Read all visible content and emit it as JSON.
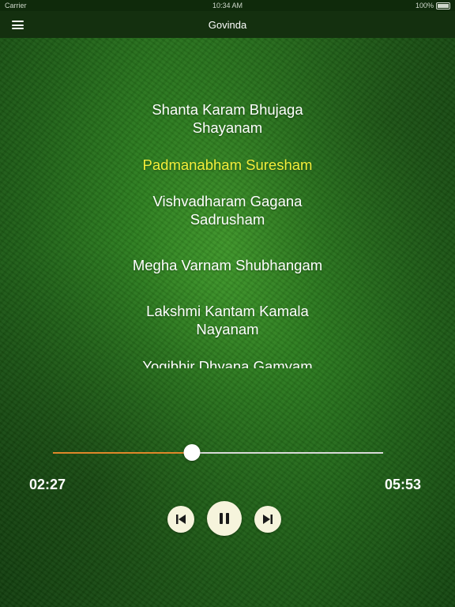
{
  "status": {
    "carrier": "Carrier",
    "time": "10:34 AM",
    "battery": "100%"
  },
  "nav": {
    "title": "Govinda",
    "menu_icon": "hamburger-menu-icon"
  },
  "lyrics": {
    "lines": [
      "Shanta Karam Bhujaga Shayanam",
      "Padmanabham Suresham",
      "Vishvadharam Gagana Sadrusham",
      "Megha Varnam Shubhangam",
      "Lakshmi Kantam Kamala Nayanam",
      "Yogibhir Dhyana Gamyam"
    ],
    "active_index": 1,
    "active_color": "#f4ef3a"
  },
  "player": {
    "elapsed": "02:27",
    "total": "05:53",
    "progress": 0.42,
    "progress_color": "#e0872a",
    "prev_icon": "skip-previous-icon",
    "play_icon": "pause-icon",
    "next_icon": "skip-next-icon"
  }
}
